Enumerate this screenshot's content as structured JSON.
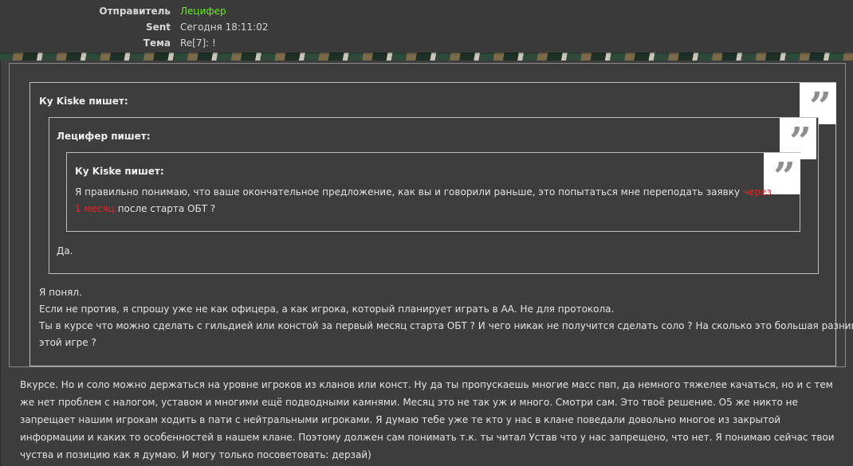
{
  "header": {
    "sender_label": "Отправитель",
    "sender_value": "Лецифер",
    "sent_label": "Sent",
    "sent_value": "Сегодня 18:11:02",
    "subject_label": "Тема",
    "subject_value": "Re[7]: !"
  },
  "quote_icon": "quote-mark-icon",
  "quote_glyph": "”",
  "quotes": {
    "level1_author": "Ку Kiske пишет:",
    "level2_author": "Лецифер пишет:",
    "level3_author": "Ку Kiske пишет:",
    "level3_text_before": "Я правильно понимаю, что ваше окончательное предложение, как вы и говорили раньше, это попытаться мне переподать заявку ",
    "level3_highlight": "через 1 месяц",
    "level3_text_after": " после старта ОБТ ?",
    "level2_text": "Да.",
    "level1_lines": [
      "Я понял.",
      "Если не против, я спрошу уже не как офицера, а как игрока, который планирует играть в АА. Не для протокола.",
      "Ты в курсе что можно сделать с гильдией или констой за первый месяц старта ОБТ ? И чего никак не получится сделать соло ? На сколько это большая разница в",
      "этой игре ?"
    ]
  },
  "reply_text": "Вкурсе. Но и соло можно держаться на уровне игроков из кланов или конст. Ну да ты пропускаешь многие масс пвп, да немного тяжелее качаться, но и с тем же нет проблем с налогом, уставом и многими ещё подводными камнями. Месяц это не так уж и много. Смотри сам. Это твоё решение. О5 же никто не запрещает нашим игрокам ходить в пати с нейтральными игроками. Я думаю тебе уже те кто у нас в клане поведали довольно многое из закрытой информации и каких то особенностей в нашем клане. Поэтому должен сам понимать т.к. ты читал Устав что у нас запрещено, что нет. Я понимаю сейчас твои чуства и позицию как я думаю. И могу только посоветовать: дерзай)",
  "colors": {
    "sender": "#66ee22",
    "highlight": "#ee2222",
    "panel": "#3d3d3d",
    "header": "#3a3a3a"
  }
}
